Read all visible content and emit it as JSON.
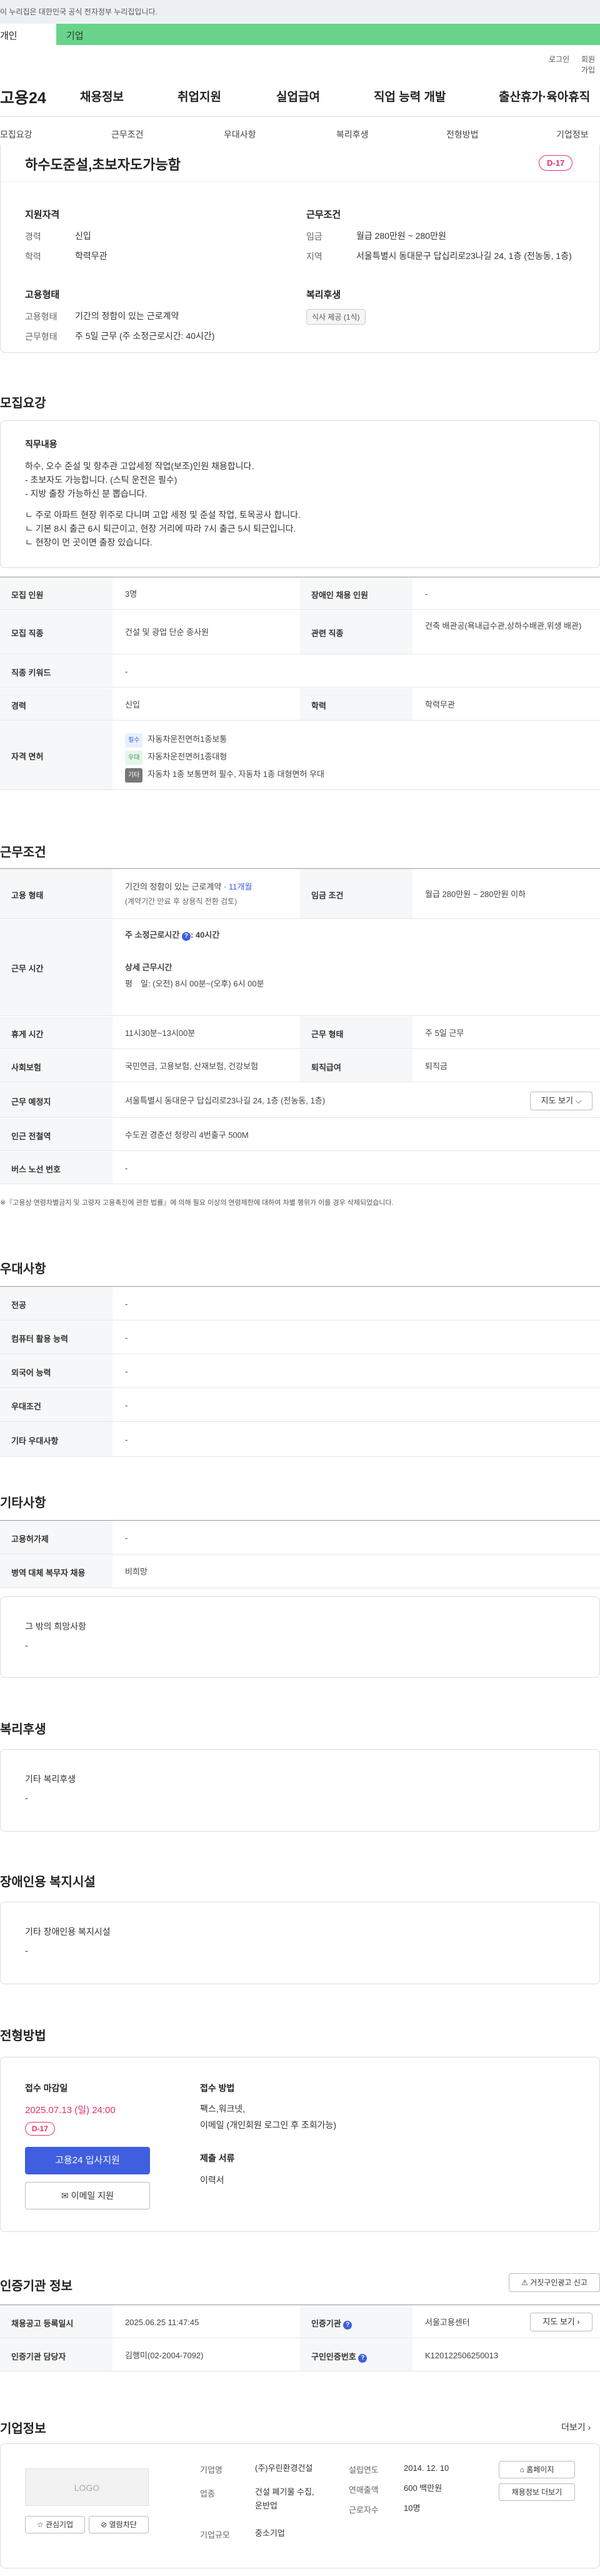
{
  "gov_bar": {
    "text": "이 누리집은 대한민국 공식 전자정부 누리집입니다."
  },
  "top_tabs": {
    "personal": "개인",
    "company": "기업"
  },
  "util": {
    "login": "로그인",
    "signup": "회원가입"
  },
  "logo": "고용24",
  "gnb": [
    "채용정보",
    "취업지원",
    "실업급여",
    "직업 능력 개발",
    "출산휴가·육아휴직"
  ],
  "anchors": [
    "모집요강",
    "근무조건",
    "우대사항",
    "복리후생",
    "전형방법",
    "기업정보"
  ],
  "summary": {
    "title": "하수도준설,초보자도가능함",
    "dday": "D-17",
    "qual_title": "지원자격",
    "career_label": "경력",
    "career": "신입",
    "edu_label": "학력",
    "edu": "학력무관",
    "cond_title": "근무조건",
    "wage_label": "임금",
    "wage": "월급 280만원 ~ 280만원",
    "loc_label": "지역",
    "loc": "서울특별시 동대문구 답십리로23나길 24, 1층 (전농동, 1층)",
    "emp_title": "고용형태",
    "emp_label": "고용형태",
    "emp": "기간의 정함이 있는 근로계약",
    "hours_label": "근무형태",
    "hours": "주 5일 근무 (주 소정근로시간: 40시간)",
    "welfare_title": "복리후생",
    "welfare_chip": "식사 제공 (1식)"
  },
  "recruit": {
    "title": "모집요강",
    "duty_title": "직무내용",
    "duty_lines": [
      "하수, 오수 준설 및 항추관 고압세정 작업(보조)인원 채용합니다.",
      "- 초보자도 가능합니다. (스틱 운전은 필수)",
      "- 지방 출장 가능하신 분 뽑습니다.",
      "",
      "ㄴ 주로 아파트 현장 위주로 다니며 고압 세정 및 준설 작업, 토목공사 합니다.",
      "ㄴ 기본 8시 출근 6시 퇴근이고, 현장 거리에 따라 7시 출근 5시 퇴근입니다.",
      "ㄴ 현장이 먼 곳이면 출장 있습니다."
    ],
    "count_label": "모집 인원",
    "count": "3명",
    "disabled_label": "장애인 채용 인원",
    "disabled": "-",
    "job_label": "모집 직종",
    "job": "건설 및 광업 단순 종사원",
    "related_label": "관련 직종",
    "related": "건축 배관공(욕내급수관,상하수배관,위생 배관)",
    "kw_label": "직종 키워드",
    "kw": "-",
    "career_label": "경력",
    "career": "신입",
    "edu_label": "학력",
    "edu": "학력무관",
    "lic_label": "자격 면허",
    "lic_tags": [
      "필수",
      "우대",
      "기타"
    ],
    "lic_items": [
      "자동차운전면허1종보통",
      "자동차운전면허1종대형",
      "자동차 1종 보통면허 필수, 자동차 1종 대형면허 우대"
    ]
  },
  "work": {
    "title": "근무조건",
    "emp_label": "고용 형태",
    "emp": "기간의 정함이 있는 근로계약",
    "emp_period": "11개월",
    "emp_note": "(계약기간 만료 후 상용직 전환 검토)",
    "wage_label": "임금 조건",
    "wage": "월급 280만원 ~ 280만원 이하",
    "hours_label": "근무 시간",
    "std_hours_label": "주 소정근로시간",
    "std_hours": "40시간",
    "detail_hours_label": "상세 근무시간",
    "detail_hours": "평　일: (오전) 8시 00분~(오후) 6시 00분",
    "break_label": "휴게 시간",
    "break": "11시30분~13시00분",
    "shift_label": "근무 형태",
    "shift": "주 5일 근무",
    "ins_label": "사회보험",
    "ins": "국민연금, 고용보험, 산재보험, 건강보험",
    "sev_label": "퇴직급여",
    "sev": "퇴직금",
    "place_label": "근무 예정지",
    "place": "서울특별시 동대문구 답십리로23나길 24, 1층 (전농동, 1층)",
    "map_btn": "지도 보기",
    "subway_label": "인근 전철역",
    "subway": "수도권 경춘선 청량리 4번출구 500M",
    "bus_label": "버스 노선 번호",
    "bus": "-",
    "note": "※『고용상 연령차별금지 및 고령자 고용촉진에 관한 법률』에 의해 필요 이상의 연령제한에 대하여 차별 행위가 이를 경우 삭제되었습니다."
  },
  "prefer": {
    "title": "우대사항",
    "rows": [
      {
        "k": "전공",
        "v": "-"
      },
      {
        "k": "컴퓨터 활용 능력",
        "v": "-"
      },
      {
        "k": "외국어 능력",
        "v": "-"
      },
      {
        "k": "우대조건",
        "v": "-"
      },
      {
        "k": "기타 우대사항",
        "v": "-"
      }
    ]
  },
  "etc": {
    "title": "기타사항",
    "rows": [
      {
        "k": "고용허가제",
        "v": "-"
      },
      {
        "k": "병역 대체 복무자 채용",
        "v": "비희망"
      }
    ],
    "box_title": "그 밖의 희망사항",
    "box_val": "-"
  },
  "welfare": {
    "title": "복리후생",
    "box_title": "기타 복리후생",
    "box_val": "-"
  },
  "disab": {
    "title": "장애인용 복지시설",
    "box_title": "기타 장애인용 복지시설",
    "box_val": "-"
  },
  "process": {
    "title": "전형방법",
    "deadline_label": "접수 마감일",
    "deadline": "2025.07.13 (일) 24:00",
    "dday": "D-17",
    "apply_btn": "고용24 입사지원",
    "email_btn": "이메일 지원",
    "method_label": "접수 방법",
    "methods": [
      "팩스,워크넷,",
      "이메일 (개인회원 로그인 후 조회가능)"
    ],
    "docs_label": "제출 서류",
    "docs": "이력서"
  },
  "agency": {
    "title": "인증기관 정보",
    "report_btn": "거짓구인광고 신고",
    "date_label": "채용공고 등록일시",
    "date": "2025.06.25 11:47:45",
    "org_label": "인증기관",
    "org": "서울고용센터",
    "map_btn": "지도 보기",
    "mgr_label": "인증기관 담당자",
    "mgr": "김행미(02-2004-7092)",
    "id_label": "구인인증번호",
    "id": "K120122506250013"
  },
  "company": {
    "title": "기업정보",
    "more": "더보기",
    "logo": "LOGO",
    "fav_btn": "관심기업",
    "block_btn": "열람차단",
    "name_label": "기업명",
    "name": "(주)우린환경건설",
    "biz_label": "업종",
    "biz": "건설 폐기물 수집, 운반업",
    "size_label": "기업규모",
    "size": "중소기업",
    "est_label": "설립연도",
    "est": "2014. 12. 10",
    "sales_label": "연매출액",
    "sales": "600 백만원",
    "emp_label": "근로자수",
    "emp": "10명",
    "home_btn": "홈페이지",
    "more_btn": "채용정보 더보기"
  },
  "colors": {
    "accent": "#3f5ee0",
    "dday": "#e3306d",
    "tab_green": "#69d38b"
  }
}
